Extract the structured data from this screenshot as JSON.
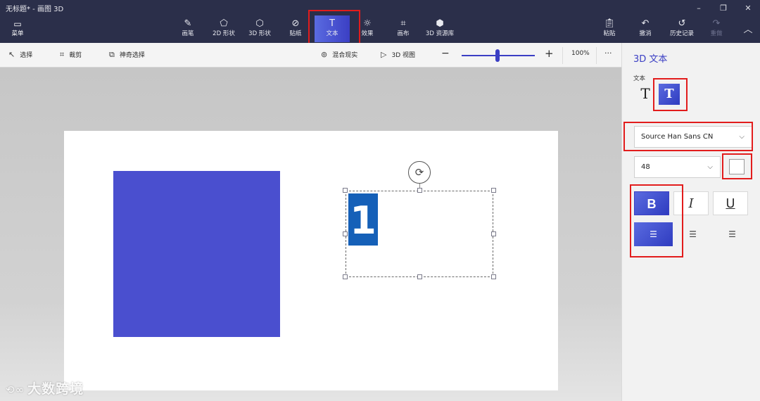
{
  "window": {
    "title": "无标题* - 画图 3D",
    "minimize": "–",
    "maximize": "❐",
    "close": "✕"
  },
  "ribbon": {
    "menu": {
      "label": "菜单",
      "icon": "folder-icon"
    },
    "tools": [
      {
        "label": "画笔",
        "icon": "brush-icon"
      },
      {
        "label": "2D 形状",
        "icon": "shapes-2d-icon"
      },
      {
        "label": "3D 形状",
        "icon": "cube-icon"
      },
      {
        "label": "贴纸",
        "icon": "sticker-icon"
      },
      {
        "label": "文本",
        "icon": "text-icon"
      },
      {
        "label": "效果",
        "icon": "effects-icon"
      },
      {
        "label": "画布",
        "icon": "canvas-icon"
      },
      {
        "label": "3D 资源库",
        "icon": "library-icon"
      }
    ],
    "paste": "粘贴",
    "undo": "撤消",
    "history": "历史记录",
    "redo": "重做",
    "collapse": "︿"
  },
  "toolbar": {
    "select": "选择",
    "crop": "裁剪",
    "magic_select": "神奇选择",
    "mixed_reality": "混合现实",
    "view_3d": "3D 视图",
    "zoom_out": "−",
    "zoom_in": "+",
    "zoom_level": "100%",
    "more": "···"
  },
  "canvas": {
    "text_content": "1",
    "rotate_icon": "rotate-icon"
  },
  "panel": {
    "title": "3D 文本",
    "text_label": "文本",
    "plain_text_glyph": "T",
    "d3_text_glyph": "T",
    "font": "Source Han Sans CN",
    "size": "48",
    "bold": "B",
    "italic": "I",
    "underline": "U",
    "text_color": "#ffffff"
  },
  "watermark": "大数跨境",
  "colors": {
    "accent": "#3b3fc4",
    "shape": "#4a4fcf",
    "text_block": "#1560b8",
    "highlight": "#e21c1c"
  }
}
